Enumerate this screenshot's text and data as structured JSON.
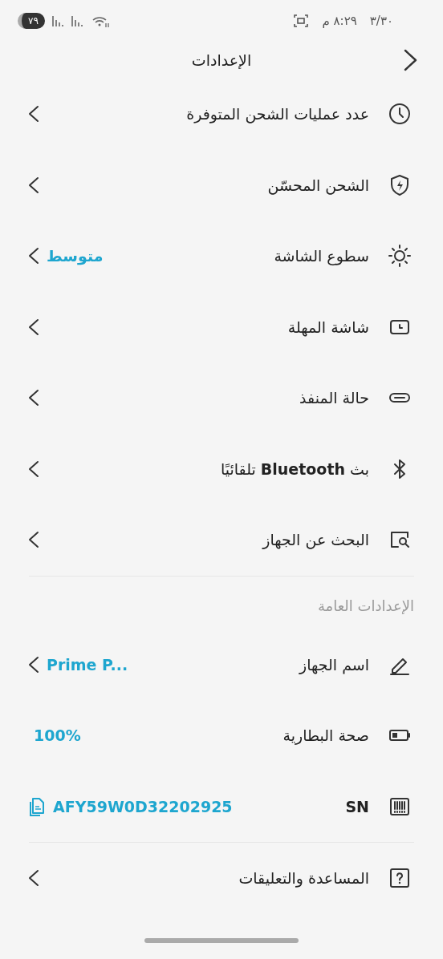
{
  "status_bar": {
    "date": "٣/٣٠",
    "time": "٨:٢٩ م",
    "battery": "٧٩"
  },
  "header": {
    "title": "الإعدادات"
  },
  "sections": [
    {
      "items": [
        {
          "label": "عدد عمليات الشحن المتوفرة",
          "chevron": true
        },
        {
          "label": "الشحن المحسّن",
          "chevron": true
        },
        {
          "label": "سطوع الشاشة",
          "value": "متوسط",
          "chevron": true
        },
        {
          "label": "شاشة المهلة",
          "chevron": true
        },
        {
          "label": "حالة المنفذ",
          "chevron": true
        },
        {
          "label": "بث **Bluetooth** تلقائيًا",
          "chevron": true
        },
        {
          "label": "البحث عن الجهاز",
          "chevron": true,
          "divider_after": true
        }
      ]
    },
    {
      "title": "الإعدادات العامة",
      "items": [
        {
          "label": "اسم الجهاز",
          "value": "Prime P...",
          "chevron": true
        },
        {
          "label": "صحة البطارية",
          "value": "100%",
          "chevron": false
        },
        {
          "label": "SN",
          "label_bold": true,
          "value": "AFY59W0D32202925",
          "chevron": false,
          "copyable": true,
          "divider_after": true
        },
        {
          "label": "المساعدة والتعليقات",
          "chevron": true
        }
      ]
    }
  ]
}
